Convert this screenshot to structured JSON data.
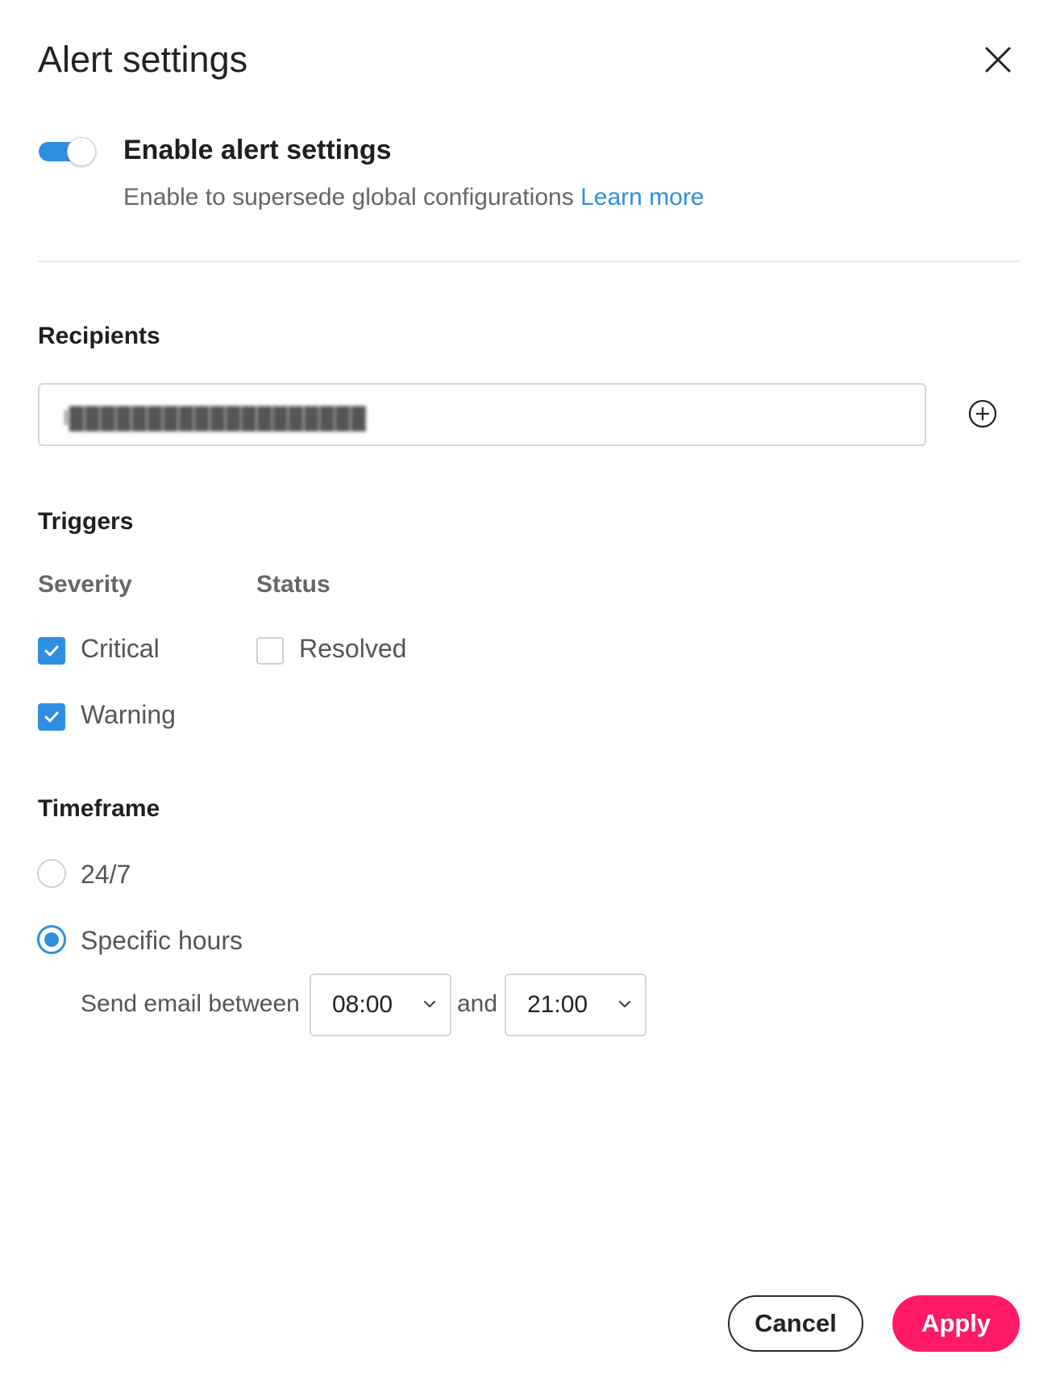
{
  "dialog": {
    "title": "Alert settings"
  },
  "enable": {
    "label": "Enable alert settings",
    "description": "Enable to supersede global configurations",
    "learn_more": "Learn more",
    "enabled": true
  },
  "recipients": {
    "title": "Recipients",
    "value": "l███████████████████"
  },
  "triggers": {
    "title": "Triggers",
    "severity": {
      "label": "Severity",
      "options": [
        {
          "label": "Critical",
          "checked": true
        },
        {
          "label": "Warning",
          "checked": true
        }
      ]
    },
    "status": {
      "label": "Status",
      "options": [
        {
          "label": "Resolved",
          "checked": false
        }
      ]
    }
  },
  "timeframe": {
    "title": "Timeframe",
    "options": [
      {
        "label": "24/7",
        "selected": false
      },
      {
        "label": "Specific hours",
        "selected": true
      }
    ],
    "send_label": "Send email between",
    "and_label": "and",
    "start": "08:00",
    "end": "21:00"
  },
  "footer": {
    "cancel": "Cancel",
    "apply": "Apply"
  },
  "colors": {
    "accent": "#2e8fe0",
    "apply": "#ff1a66"
  }
}
